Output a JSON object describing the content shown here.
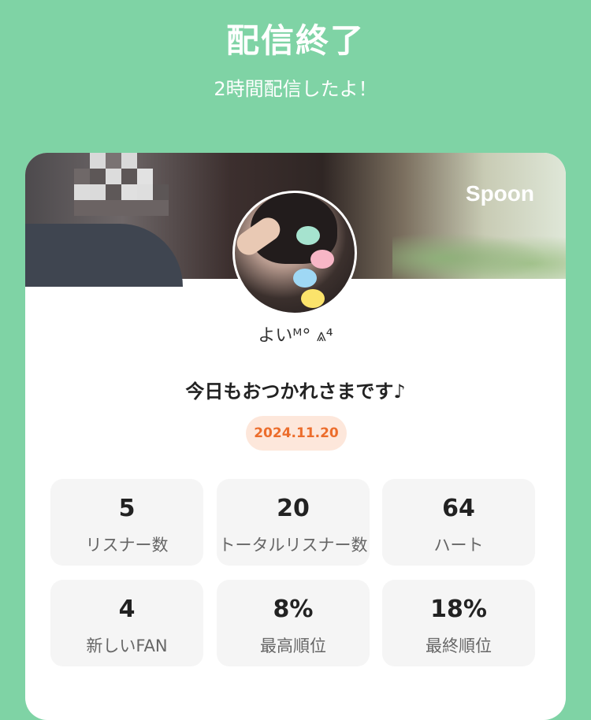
{
  "header": {
    "title": "配信終了",
    "subtitle": "2時間配信したよ！"
  },
  "card": {
    "brand": "Spoon",
    "username": "よいᴹ° ⩓⁴",
    "message": "今日もおつかれさまです♪",
    "date": "2024.11.20",
    "stats": [
      {
        "value": "5",
        "label": "リスナー数"
      },
      {
        "value": "20",
        "label": "トータルリスナー数"
      },
      {
        "value": "64",
        "label": "ハート"
      },
      {
        "value": "4",
        "label": "新しいFAN"
      },
      {
        "value": "8%",
        "label": "最高順位"
      },
      {
        "value": "18%",
        "label": "最終順位"
      }
    ]
  },
  "colors": {
    "background": "#7fd3a5",
    "date_text": "#ec6d2c",
    "date_bg": "#fde7db",
    "stat_bg": "#f5f5f5"
  }
}
